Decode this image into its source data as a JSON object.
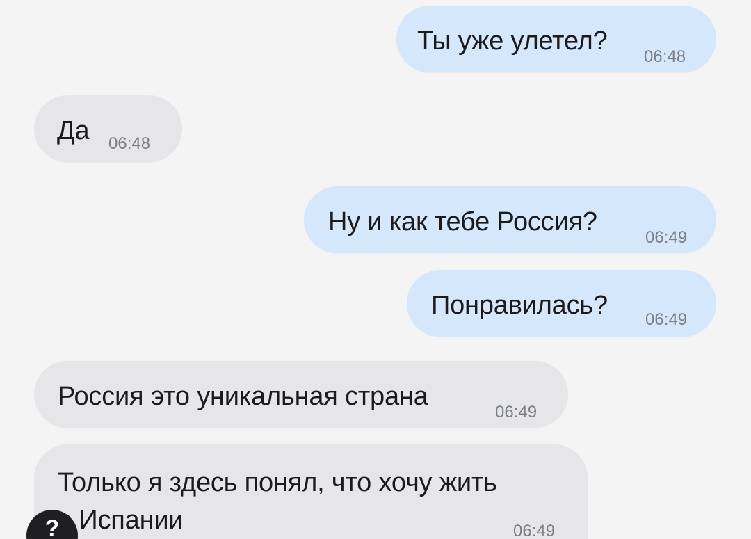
{
  "messages": [
    {
      "direction": "outgoing",
      "text": "Ты уже улетел?",
      "time": "06:48"
    },
    {
      "direction": "incoming",
      "text": "Да",
      "time": "06:48"
    },
    {
      "direction": "outgoing",
      "text": "Ну и как тебе Россия?",
      "time": "06:49"
    },
    {
      "direction": "outgoing",
      "text": "Понравилась?",
      "time": "06:49"
    },
    {
      "direction": "incoming",
      "text": "Россия это уникальная страна",
      "time": "06:49"
    },
    {
      "direction": "incoming",
      "text_lines": [
        "Только я здесь понял, что хочу жить",
        "в Испании"
      ],
      "time": "06:49"
    }
  ],
  "avatar": {
    "icon": "person-avatar-icon",
    "glyph": "?"
  },
  "colors": {
    "background": "#f4f4f5",
    "outgoing_bubble": "#d4e7fb",
    "incoming_bubble": "#e6e6e9",
    "time_text": "#7b7f86",
    "message_text": "#1b1b1d"
  }
}
